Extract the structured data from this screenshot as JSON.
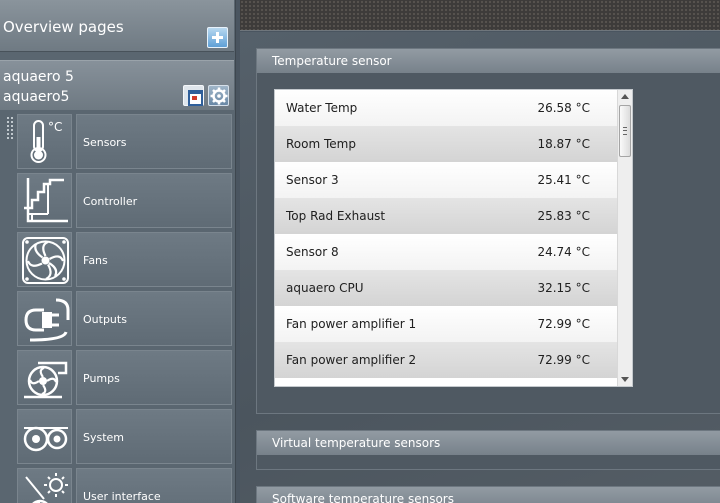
{
  "sidebar": {
    "overview_title": "Overview pages",
    "device_model": "aquaero 5",
    "device_name": "aquaero5",
    "items": [
      {
        "label": "Sensors",
        "icon": "thermometer-icon"
      },
      {
        "label": "Controller",
        "icon": "controller-chart-icon"
      },
      {
        "label": "Fans",
        "icon": "fan-icon"
      },
      {
        "label": "Outputs",
        "icon": "plug-icon"
      },
      {
        "label": "Pumps",
        "icon": "pump-icon"
      },
      {
        "label": "System",
        "icon": "system-gears-icon"
      },
      {
        "label": "User interface",
        "icon": "display-brightness-icon"
      }
    ],
    "sensors_icon_unit": "°C"
  },
  "panels": {
    "temperature": {
      "title": "Temperature sensor",
      "sensors": [
        {
          "name": "Water Temp",
          "value": "26.58 °C"
        },
        {
          "name": "Room Temp",
          "value": "18.87 °C"
        },
        {
          "name": "Sensor 3",
          "value": "25.41 °C"
        },
        {
          "name": "Top Rad Exhaust",
          "value": "25.83 °C"
        },
        {
          "name": "Sensor 8",
          "value": "24.74 °C"
        },
        {
          "name": "aquaero CPU",
          "value": "32.15 °C"
        },
        {
          "name": "Fan power amplifier 1",
          "value": "72.99 °C"
        },
        {
          "name": "Fan power amplifier 2",
          "value": "72.99 °C"
        }
      ]
    },
    "virtual": {
      "title": "Virtual temperature sensors"
    },
    "software": {
      "title": "Software temperature sensors"
    }
  },
  "colors": {
    "accent_blue": "#5f9fd6",
    "sidebar_bg": "#5a6670",
    "panel_header": "#838d96"
  }
}
